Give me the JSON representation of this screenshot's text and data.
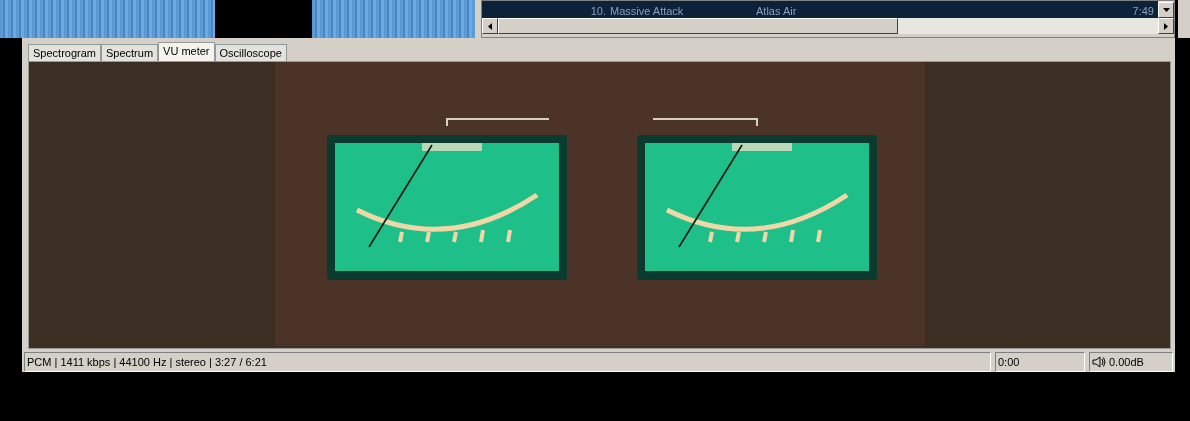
{
  "playlist": {
    "rows": [
      {
        "number": "10.",
        "artist": "Massive Attack",
        "title": "Atlas Air",
        "time": "7:49"
      }
    ]
  },
  "tabs": [
    {
      "label": "Spectrogram",
      "selected": false
    },
    {
      "label": "Spectrum",
      "selected": false
    },
    {
      "label": "VU meter",
      "selected": true
    },
    {
      "label": "Oscilloscope",
      "selected": false
    }
  ],
  "status_bar": {
    "info": "PCM | 1411 kbps | 44100 Hz | stereo | 3:27 / 6:21",
    "position": "0:00",
    "volume": "0.00dB"
  }
}
